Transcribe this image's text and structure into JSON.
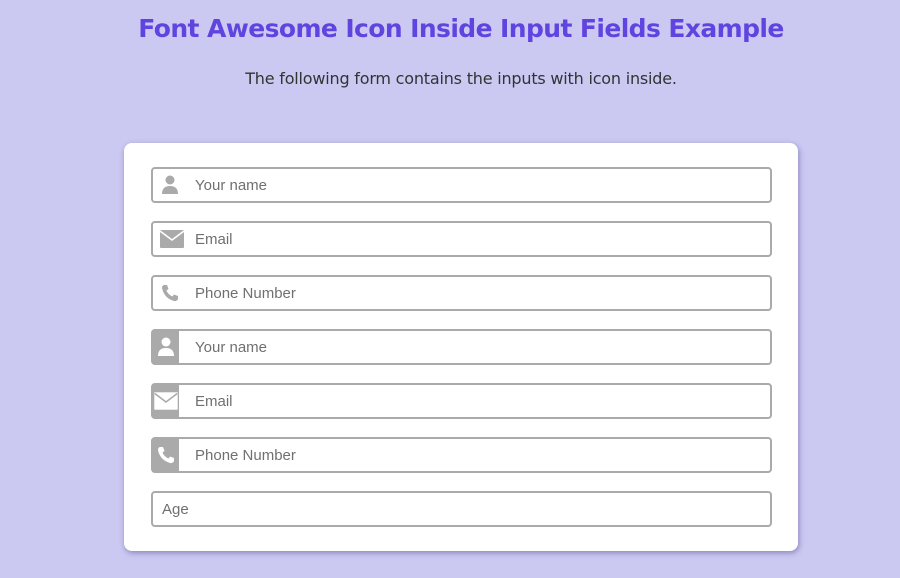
{
  "header": {
    "title": "Font Awesome Icon Inside Input Fields Example",
    "subtitle": "The following form contains the inputs with icon inside."
  },
  "colors": {
    "background": "#cbc9f2",
    "title": "#6044e0",
    "icon_gray": "#aaaaaa",
    "border": "#aaaaaa"
  },
  "form": {
    "fields": [
      {
        "icon": "user-icon",
        "style": "inline",
        "placeholder": "Your name",
        "value": ""
      },
      {
        "icon": "envelope-icon",
        "style": "inline",
        "placeholder": "Email",
        "value": ""
      },
      {
        "icon": "phone-icon",
        "style": "inline",
        "placeholder": "Phone Number",
        "value": ""
      },
      {
        "icon": "user-icon",
        "style": "boxed",
        "placeholder": "Your name",
        "value": ""
      },
      {
        "icon": "envelope-icon",
        "style": "boxed",
        "placeholder": "Email",
        "value": ""
      },
      {
        "icon": "phone-icon",
        "style": "boxed",
        "placeholder": "Phone Number",
        "value": ""
      },
      {
        "icon": "none",
        "style": "plain",
        "placeholder": "Age",
        "value": ""
      }
    ]
  }
}
